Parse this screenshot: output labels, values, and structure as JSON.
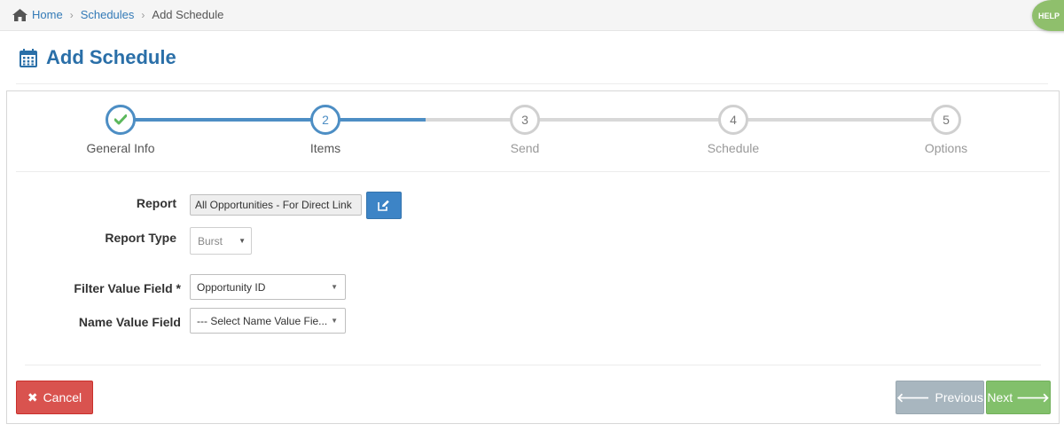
{
  "breadcrumb": {
    "home": "Home",
    "schedules": "Schedules",
    "current": "Add Schedule"
  },
  "help_label": "HELP",
  "page_title": "Add Schedule",
  "wizard": {
    "steps": [
      {
        "number": "",
        "label": "General Info",
        "state": "complete"
      },
      {
        "number": "2",
        "label": "Items",
        "state": "active"
      },
      {
        "number": "3",
        "label": "Send",
        "state": "pending"
      },
      {
        "number": "4",
        "label": "Schedule",
        "state": "pending"
      },
      {
        "number": "5",
        "label": "Options",
        "state": "pending"
      }
    ]
  },
  "form": {
    "report_label": "Report",
    "report_value": "All Opportunities - For Direct Link",
    "report_type_label": "Report Type",
    "report_type_value": "Burst",
    "filter_value_label": "Filter Value Field *",
    "filter_value_value": "Opportunity ID",
    "name_value_label": "Name Value Field",
    "name_value_value": "--- Select Name Value Fie..."
  },
  "buttons": {
    "cancel": "Cancel",
    "previous": "Previous",
    "next": "Next"
  },
  "colors": {
    "accent": "#4d8ec4",
    "title": "#2a6fa8",
    "cancel": "#d9534f",
    "previous": "#a8b6bf",
    "next": "#82c06b",
    "check": "#5cb85c"
  }
}
